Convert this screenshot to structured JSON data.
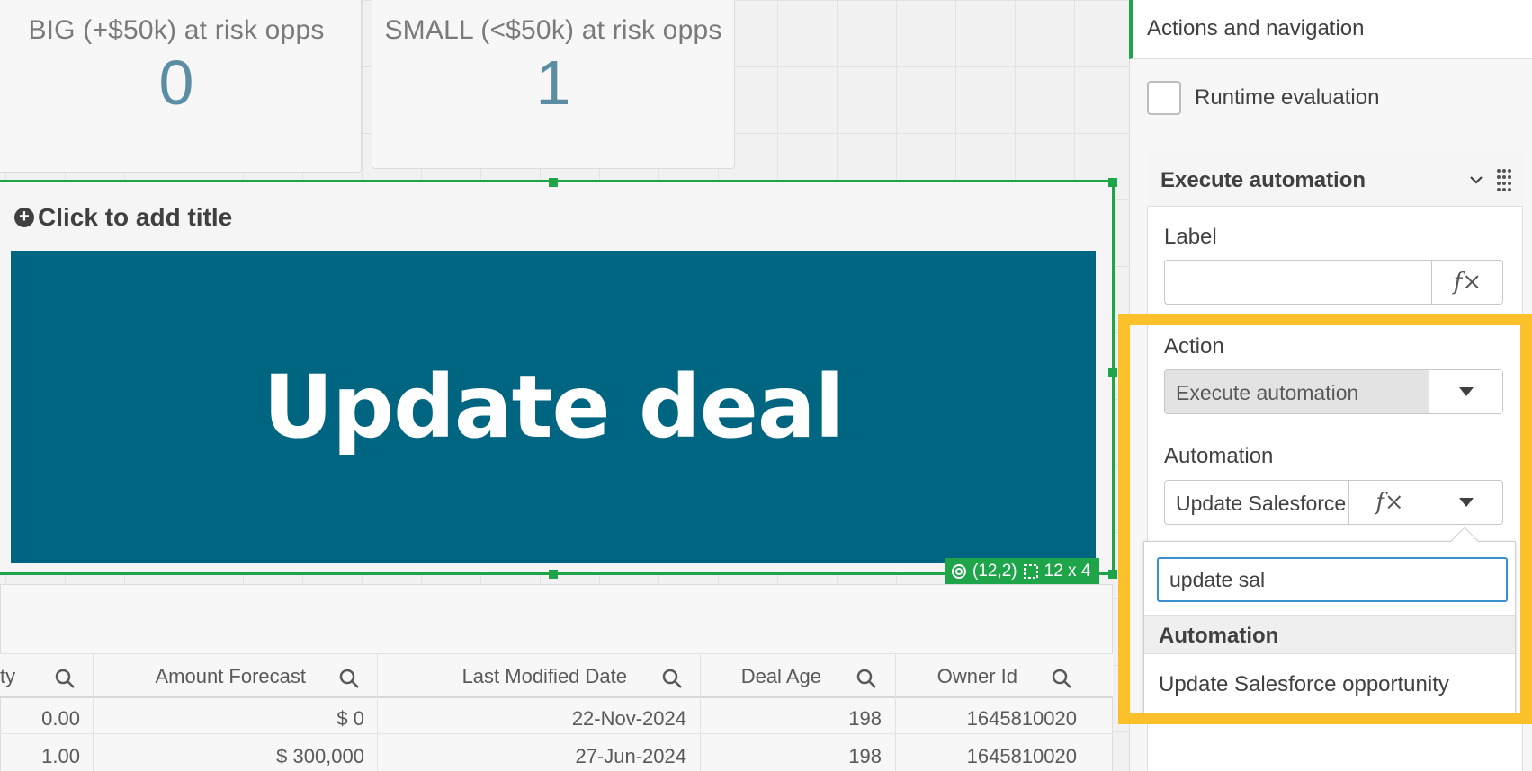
{
  "kpis": [
    {
      "title": "BIG (+$50k) at risk opps",
      "value": "0"
    },
    {
      "title": "SMALL (<$50k) at risk opps",
      "value": "1"
    }
  ],
  "button_object": {
    "add_title": "Click to add title",
    "label": "Update deal",
    "position": "(12,2)",
    "size": "12 x 4"
  },
  "table": {
    "headers": [
      "ty",
      "Amount Forecast",
      "Last Modified Date",
      "Deal Age",
      "Owner Id"
    ],
    "rows": [
      [
        "0.00",
        "$ 0",
        "22-Nov-2024",
        "198",
        "1645810020"
      ],
      [
        "1.00",
        "$ 300,000",
        "27-Jun-2024",
        "198",
        "1645810020"
      ]
    ]
  },
  "panel": {
    "title": "Actions and navigation",
    "runtime_evaluation_label": "Runtime evaluation",
    "runtime_evaluation_checked": false,
    "section_title": "Execute automation",
    "label_field": {
      "label": "Label",
      "value": "",
      "fx": "fx"
    },
    "action_field": {
      "label": "Action",
      "value": "Execute automation"
    },
    "automation_field": {
      "label": "Automation",
      "value": "Update Salesforce"
    },
    "dropdown": {
      "search_value": "update sal",
      "group_label": "Automation",
      "options": [
        "Update Salesforce opportunity"
      ]
    }
  },
  "colors": {
    "selection": "#1ea54a",
    "button_bg": "#006580",
    "highlight": "#fcc02a",
    "kpi_value": "#5b8ea3"
  }
}
